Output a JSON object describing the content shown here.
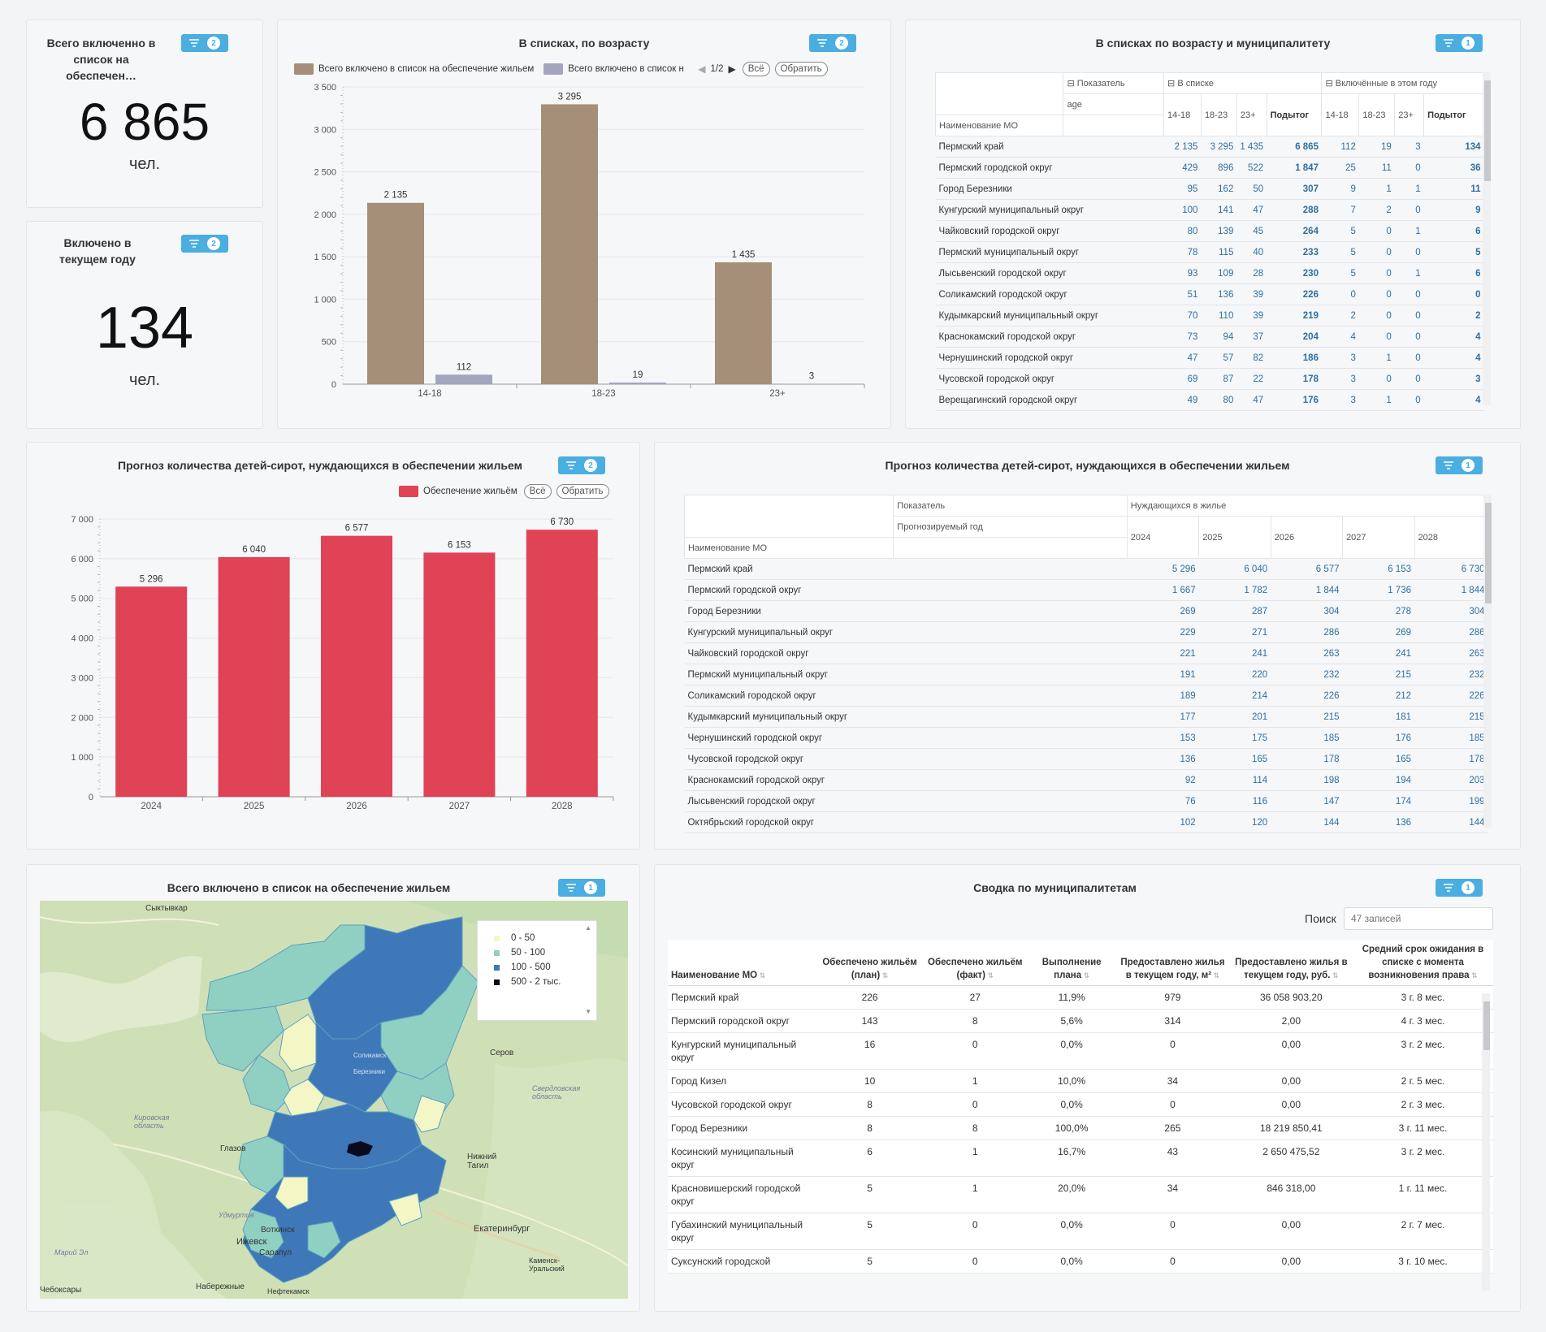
{
  "kpi1": {
    "title": "Всего включенно в список на обеспечен…",
    "value": "6 865",
    "unit": "чел.",
    "filters": "2"
  },
  "kpi2": {
    "title": "Включено в текущем году",
    "value": "134",
    "unit": "чел.",
    "filters": "2"
  },
  "age_chart": {
    "title": "В списках, по возрасту",
    "filters": "2",
    "legend": [
      "Всего включено в список на обеспечение жильем",
      "Всего включено в список н"
    ],
    "pager": "1/2",
    "btn_all": "Всё",
    "btn_invert": "Обратить"
  },
  "forecast_chart": {
    "title": "Прогноз количества детей-сирот, нуждающихся в обеспечении жильем",
    "filters": "2",
    "legend": "Обеспечение жильём",
    "btn_all": "Всё",
    "btn_invert": "Обратить"
  },
  "chart_data": [
    {
      "type": "bar",
      "categories": [
        "14-18",
        "18-23",
        "23+"
      ],
      "series": [
        {
          "name": "Всего включено в список на обеспечение жильем",
          "values": [
            2135,
            3295,
            1435
          ],
          "labels": [
            "2 135",
            "3 295",
            "1 435"
          ],
          "color": "#a58f78"
        },
        {
          "name": "Всего включено в список н",
          "values": [
            112,
            19,
            3
          ],
          "labels": [
            "112",
            "19",
            "3"
          ],
          "color": "#a3a4bd"
        }
      ],
      "title": "В списках, по возрасту",
      "ylim": [
        0,
        3500
      ],
      "yticks": [
        "0",
        "500",
        "1 000",
        "1 500",
        "2 000",
        "2 500",
        "3 000",
        "3 500"
      ],
      "grid": true,
      "legend": "top-left"
    },
    {
      "type": "bar",
      "categories": [
        "2024",
        "2025",
        "2026",
        "2027",
        "2028"
      ],
      "series": [
        {
          "name": "Обеспечение жильём",
          "values": [
            5296,
            6040,
            6577,
            6153,
            6730
          ],
          "labels": [
            "5 296",
            "6 040",
            "6 577",
            "6 153",
            "6 730"
          ],
          "color": "#e04356"
        }
      ],
      "title": "Прогноз количества детей-сирот, нуждающихся в обеспечении жильем",
      "ylim": [
        0,
        7000
      ],
      "yticks": [
        "0",
        "1 000",
        "2 000",
        "3 000",
        "4 000",
        "5 000",
        "6 000",
        "7 000"
      ],
      "grid": true,
      "legend": "top-right"
    }
  ],
  "pivot1": {
    "title": "В списках по возрасту и муниципалитету",
    "filters": "1",
    "h_indicator": "⊟ Показатель",
    "h_in_list": "⊟ В списке",
    "h_included": "⊟ Включённые в этом году",
    "h_age": "age",
    "h_mo": "Наименование МО",
    "cols": [
      "14-18",
      "18-23",
      "23+",
      "Подытог",
      "14-18",
      "18-23",
      "23+",
      "Подытог"
    ],
    "rows": [
      [
        "Пермский край",
        "2 135",
        "3 295",
        "1 435",
        "6 865",
        "112",
        "19",
        "3",
        "134"
      ],
      [
        "Пермский городской округ",
        "429",
        "896",
        "522",
        "1 847",
        "25",
        "11",
        "0",
        "36"
      ],
      [
        "Город Березники",
        "95",
        "162",
        "50",
        "307",
        "9",
        "1",
        "1",
        "11"
      ],
      [
        "Кунгурский муниципальный округ",
        "100",
        "141",
        "47",
        "288",
        "7",
        "2",
        "0",
        "9"
      ],
      [
        "Чайковский городской округ",
        "80",
        "139",
        "45",
        "264",
        "5",
        "0",
        "1",
        "6"
      ],
      [
        "Пермский муниципальный округ",
        "78",
        "115",
        "40",
        "233",
        "5",
        "0",
        "0",
        "5"
      ],
      [
        "Лысьвенский городской округ",
        "93",
        "109",
        "28",
        "230",
        "5",
        "0",
        "1",
        "6"
      ],
      [
        "Соликамский городской округ",
        "51",
        "136",
        "39",
        "226",
        "0",
        "0",
        "0",
        "0"
      ],
      [
        "Кудымкарский муниципальный округ",
        "70",
        "110",
        "39",
        "219",
        "2",
        "0",
        "0",
        "2"
      ],
      [
        "Краснокамский городской округ",
        "73",
        "94",
        "37",
        "204",
        "4",
        "0",
        "0",
        "4"
      ],
      [
        "Чернушинский городской округ",
        "47",
        "57",
        "82",
        "186",
        "3",
        "1",
        "0",
        "4"
      ],
      [
        "Чусовской городской округ",
        "69",
        "87",
        "22",
        "178",
        "3",
        "0",
        "0",
        "3"
      ],
      [
        "Верещагинский городской округ",
        "49",
        "80",
        "47",
        "176",
        "3",
        "1",
        "0",
        "4"
      ]
    ]
  },
  "pivot2": {
    "title": "Прогноз количества детей-сирот, нуждающихся в обеспечении жильем",
    "filters": "1",
    "h_indicator": "Показатель",
    "h_year": "Прогнозируемый год",
    "h_need": "Нуждающихся в жилье",
    "h_mo": "Наименование МО",
    "cols": [
      "2024",
      "2025",
      "2026",
      "2027",
      "2028"
    ],
    "rows": [
      [
        "Пермский край",
        "5 296",
        "6 040",
        "6 577",
        "6 153",
        "6 730"
      ],
      [
        "Пермский городской округ",
        "1 667",
        "1 782",
        "1 844",
        "1 736",
        "1 844"
      ],
      [
        "Город Березники",
        "269",
        "287",
        "304",
        "278",
        "304"
      ],
      [
        "Кунгурский муниципальный округ",
        "229",
        "271",
        "286",
        "269",
        "286"
      ],
      [
        "Чайковский городской округ",
        "221",
        "241",
        "263",
        "241",
        "263"
      ],
      [
        "Пермский муниципальный округ",
        "191",
        "220",
        "232",
        "215",
        "232"
      ],
      [
        "Соликамский городской округ",
        "189",
        "214",
        "226",
        "212",
        "226"
      ],
      [
        "Кудымкарский муниципальный округ",
        "177",
        "201",
        "215",
        "181",
        "215"
      ],
      [
        "Чернушинский городской округ",
        "153",
        "175",
        "185",
        "176",
        "185"
      ],
      [
        "Чусовской городской округ",
        "136",
        "165",
        "178",
        "165",
        "178"
      ],
      [
        "Краснокамский городской округ",
        "92",
        "114",
        "198",
        "194",
        "203"
      ],
      [
        "Лысьвенский городской округ",
        "76",
        "116",
        "147",
        "174",
        "199"
      ],
      [
        "Октябрьский городской округ",
        "102",
        "120",
        "144",
        "136",
        "144"
      ]
    ]
  },
  "map": {
    "title": "Всего включено в список на обеспечение жильем",
    "filters": "1",
    "legend": [
      {
        "label": "0 - 50",
        "color": "#f3f7c6"
      },
      {
        "label": "50 - 100",
        "color": "#8fd0c3"
      },
      {
        "label": "100 - 500",
        "color": "#3e78b8"
      },
      {
        "label": "500 - 2 тыс.",
        "color": "#0a0a1e"
      }
    ],
    "places": [
      "Сыктывкар",
      "Серов",
      "Свердловская область",
      "Кировская область",
      "Глазов",
      "Нижний Тагил",
      "Удмуртия",
      "Воткинск",
      "Ижевск",
      "Сарапул",
      "Екатеринбург",
      "Каменск-Уральский",
      "Марий Эл",
      "Набережные",
      "Нефтекамск",
      "Чебоксары",
      "Соликамск",
      "Березники"
    ]
  },
  "summary": {
    "title": "Сводка по муниципалитетам",
    "filters": "1",
    "search_label": "Поиск",
    "search_placeholder": "47 записей",
    "headers": [
      "Наименование МО",
      "Обеспечено жильём (план)",
      "Обеспечено жильём (факт)",
      "Выполнение плана",
      "Предоставлено жилья в текущем году, м²",
      "Предоставлено жилья в текущем году, руб.",
      "Средний срок ожидания в списке с момента возникновения права"
    ],
    "rows": [
      [
        "Пермский край",
        "226",
        "27",
        "11,9%",
        "979",
        "36 058 903,20",
        "3 г. 8 мес."
      ],
      [
        "Пермский городской округ",
        "143",
        "8",
        "5,6%",
        "314",
        "2,00",
        "4 г. 3 мес."
      ],
      [
        "Кунгурский муниципальный округ",
        "16",
        "0",
        "0,0%",
        "0",
        "0,00",
        "3 г. 2 мес."
      ],
      [
        "Город Кизел",
        "10",
        "1",
        "10,0%",
        "34",
        "0,00",
        "2 г. 5 мес."
      ],
      [
        "Чусовской городской округ",
        "8",
        "0",
        "0,0%",
        "0",
        "0,00",
        "2 г. 3 мес."
      ],
      [
        "Город Березники",
        "8",
        "8",
        "100,0%",
        "265",
        "18 219 850,41",
        "3 г. 11 мес."
      ],
      [
        "Косинский муниципальный округ",
        "6",
        "1",
        "16,7%",
        "43",
        "2 650 475,52",
        "3 г. 2 мес."
      ],
      [
        "Красновишерский городской округ",
        "5",
        "1",
        "20,0%",
        "34",
        "846 318,00",
        "1 г. 11 мес."
      ],
      [
        "Губахинский муниципальный округ",
        "5",
        "0",
        "0,0%",
        "0",
        "0,00",
        "2 г. 7 мес."
      ],
      [
        "Суксунский городской",
        "5",
        "0",
        "0,0%",
        "0",
        "0,00",
        "3 г. 10 мес."
      ]
    ]
  }
}
